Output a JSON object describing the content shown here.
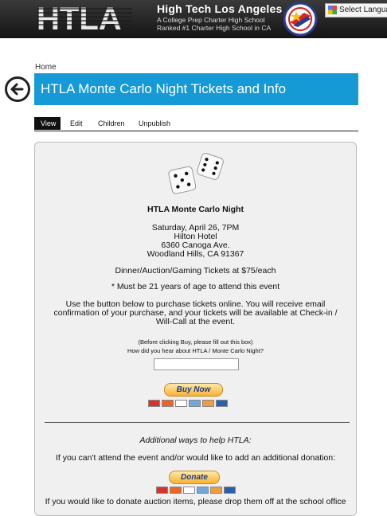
{
  "header": {
    "logo_text": "HTLA",
    "school_name": "High Tech Los Angeles",
    "tagline_line1": "A College Prep Charter High School",
    "tagline_line2": "Ranked #1 Charter High School in CA",
    "language_select": "Select Language"
  },
  "breadcrumb": "Home",
  "page_title": "HTLA Monte Carlo Night Tickets and Info",
  "tabs": [
    {
      "label": "View",
      "active": true
    },
    {
      "label": "Edit",
      "active": false
    },
    {
      "label": "Children",
      "active": false
    },
    {
      "label": "Unpublish",
      "active": false
    }
  ],
  "event": {
    "title": "HTLA Monte Carlo Night",
    "date": "Saturday, April 26, 7PM",
    "venue": "Hilton Hotel",
    "address1": "6360 Canoga Ave.",
    "address2": "Woodland Hills, CA 91367",
    "tickets": "Dinner/Auction/Gaming Tickets at $75/each",
    "age_note": "* Must be 21 years of age to attend this event",
    "purchase_line1": "Use the button below to purchase tickets online. You will receive email",
    "purchase_line2": "confirmation of your purchase, and your tickets will be available at Check-in /",
    "purchase_line3": "Will-Call at the event.",
    "form_note": "(Before clicking Buy, please fill out this box)",
    "form_question": "How did you hear about HTLA / Monte Carlo Night?",
    "buy_button": "Buy Now"
  },
  "help": {
    "heading": "Additional ways to help HTLA:",
    "donation_line": "If you can't attend the event and/or would like to add an additional donation:",
    "donate_button": "Donate",
    "auction_line": "If you would like to donate auction items, please drop them off at the school office"
  },
  "colors": {
    "title_bar": "#159ad6",
    "header_bg": "#1c1c1c"
  },
  "icons": {
    "back": "arrow-left-circle-icon",
    "dice": "dice-icon",
    "language": "google-translate-icon"
  }
}
